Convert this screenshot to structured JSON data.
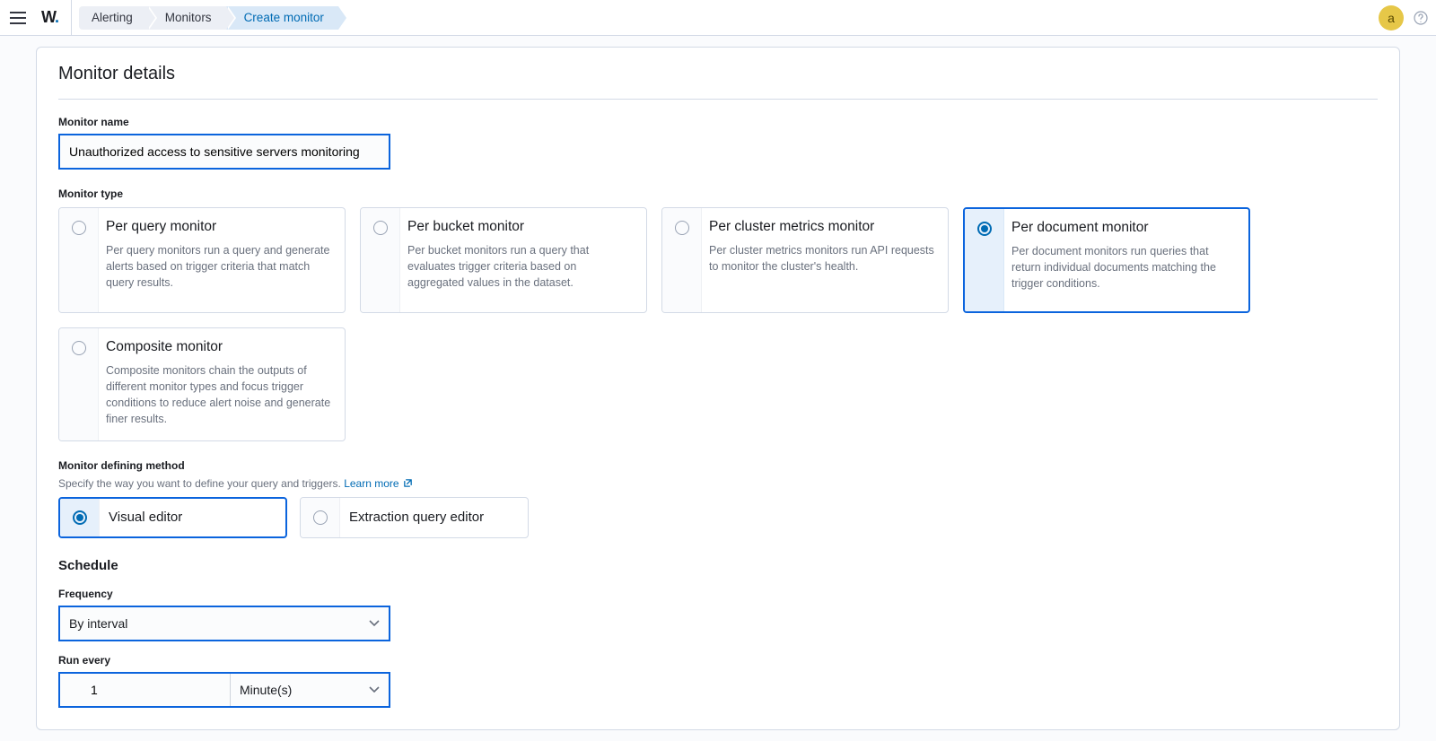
{
  "header": {
    "avatar_letter": "a"
  },
  "breadcrumbs": [
    "Alerting",
    "Monitors",
    "Create monitor"
  ],
  "page": {
    "title": "Monitor details"
  },
  "monitor_name": {
    "label": "Monitor name",
    "value": "Unauthorized access to sensitive servers monitoring"
  },
  "monitor_type": {
    "label": "Monitor type",
    "selected": 3,
    "options": [
      {
        "title": "Per query monitor",
        "desc": "Per query monitors run a query and generate alerts based on trigger criteria that match query results."
      },
      {
        "title": "Per bucket monitor",
        "desc": "Per bucket monitors run a query that evaluates trigger criteria based on aggregated values in the dataset."
      },
      {
        "title": "Per cluster metrics monitor",
        "desc": "Per cluster metrics monitors run API requests to monitor the cluster's health."
      },
      {
        "title": "Per document monitor",
        "desc": "Per document monitors run queries that return individual documents matching the trigger conditions."
      },
      {
        "title": "Composite monitor",
        "desc": "Composite monitors chain the outputs of different monitor types and focus trigger conditions to reduce alert noise and generate finer results."
      }
    ]
  },
  "defining_method": {
    "label": "Monitor defining method",
    "help": "Specify the way you want to define your query and triggers.",
    "learn_more": "Learn more",
    "selected": 0,
    "options": [
      {
        "title": "Visual editor"
      },
      {
        "title": "Extraction query editor"
      }
    ]
  },
  "schedule": {
    "title": "Schedule",
    "frequency_label": "Frequency",
    "frequency_value": "By interval",
    "run_every_label": "Run every",
    "run_every_value": "1",
    "run_every_unit": "Minute(s)"
  }
}
